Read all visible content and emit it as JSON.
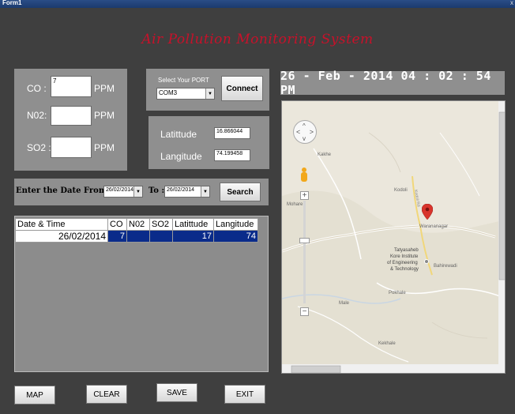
{
  "window": {
    "title": "Form1",
    "close_glyph": "x"
  },
  "app_title": "Air Pollution Monitoring System",
  "readings": {
    "co_label": "CO :",
    "co_value": "7",
    "co_unit": "PPM",
    "no2_label": "N02:",
    "no2_value": "",
    "no2_unit": "PPM",
    "so2_label": "SO2 :",
    "so2_value": "",
    "so2_unit": "PPM"
  },
  "port": {
    "label": "Select Your PORT",
    "selected": "COM3",
    "connect_label": "Connect"
  },
  "location": {
    "lat_label": "Latittude",
    "lat_value": "16.866044",
    "lon_label": "Langitude",
    "lon_value": "74.199458"
  },
  "datetime": "26 - Feb - 2014    04 : 02 : 54  PM",
  "search": {
    "from_label": "Enter the Date From :",
    "from_value": "26/02/2014",
    "to_label": "To :",
    "to_value": "26/02/2014",
    "search_label": "Search"
  },
  "table": {
    "headers": [
      "Date & Time",
      "CO",
      "N02",
      "SO2",
      "Latittude",
      "Langitude"
    ],
    "rows": [
      [
        "26/02/2014",
        "7",
        "",
        "",
        "17",
        "74"
      ]
    ]
  },
  "map": {
    "places": [
      "Kakhe",
      "Mohare",
      "Kodoli",
      "Warananagar",
      "Tatyasaheb",
      "Kore Institute",
      "of Engineering",
      "& Technology",
      "Bahirewadi",
      "Pokhale",
      "Male",
      "Kekhale",
      "Kodoli Rd"
    ],
    "zoom_in": "+",
    "zoom_out": "−",
    "marker_color": "#d8342c"
  },
  "buttons": {
    "map": "MAP",
    "clear": "CLEAR",
    "save": "SAVE",
    "exit": "EXIT"
  }
}
